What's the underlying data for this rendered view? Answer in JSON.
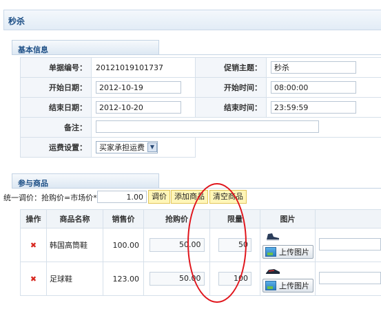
{
  "page": {
    "title": "秒杀"
  },
  "basic": {
    "header": "基本信息",
    "doc_no_label": "单据编号：",
    "doc_no": "20121019101737",
    "promo_label": "促销主题：",
    "promo": "秒杀",
    "start_date_label": "开始日期：",
    "start_date": "2012-10-19",
    "start_time_label": "开始时间：",
    "start_time": "08:00:00",
    "end_date_label": "结束日期：",
    "end_date": "2012-10-20",
    "end_time_label": "结束时间：",
    "end_time": "23:59:59",
    "remark_label": "备注：",
    "remark": "",
    "shipping_label": "运费设置：",
    "shipping": "买家承担运费"
  },
  "goods": {
    "header": "参与商品",
    "adjust_text": "统一调价：抢购价=市场价*",
    "adjust_value": "1.00",
    "btn_adjust": "调价",
    "btn_add": "添加商品",
    "btn_clear": "清空商品",
    "columns": [
      "操作",
      "商品名称",
      "销售价",
      "抢购价",
      "限量",
      "图片"
    ],
    "rows": [
      {
        "name": "韩国高筒鞋",
        "price": "100.00",
        "flash": "50.00",
        "limit": "50",
        "upload": "上传图片"
      },
      {
        "name": "足球鞋",
        "price": "123.00",
        "flash": "50.00",
        "limit": "100",
        "upload": "上传图片"
      }
    ]
  },
  "colors": {
    "annotation": "#e0141b",
    "accent": "#1d4f86",
    "button_yellow": "#fff6b8"
  }
}
